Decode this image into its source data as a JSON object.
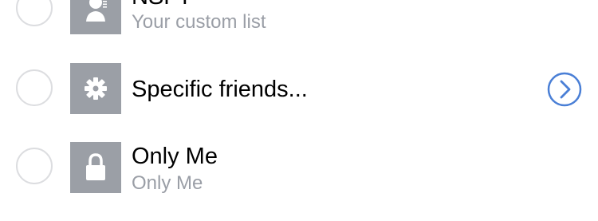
{
  "audience_list": {
    "rows": [
      {
        "title": "NSFT",
        "subtitle": "Your custom list",
        "icon": "custom-list-icon"
      },
      {
        "title": "Specific friends...",
        "subtitle": "",
        "icon": "gear-icon",
        "has_chevron": true
      },
      {
        "title": "Only Me",
        "subtitle": "Only Me",
        "icon": "lock-icon"
      }
    ]
  },
  "colors": {
    "tile_bg": "#9b9fa6",
    "radio_border": "#dcdde0",
    "subtitle": "#9a9ea6",
    "accent": "#4a7fd6"
  }
}
